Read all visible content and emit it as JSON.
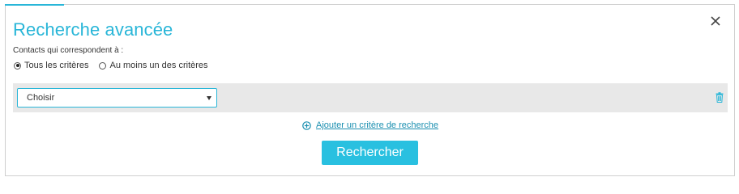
{
  "dialog": {
    "title": "Recherche avancée",
    "match_label": "Contacts qui correspondent à :",
    "match_options": [
      {
        "label": "Tous les critères",
        "checked": true
      },
      {
        "label": "Au moins un des critères",
        "checked": false
      }
    ],
    "criterion": {
      "select_value": "Choisir"
    },
    "add_criterion_label": "Ajouter un critère de recherche",
    "search_button_label": "Rechercher"
  },
  "colors": {
    "accent": "#29b6d8",
    "button": "#29c0e0",
    "row_background": "#e8e8e8"
  },
  "icons": [
    "close-icon",
    "chevron-down-icon",
    "trash-icon",
    "plus-circle-icon"
  ]
}
